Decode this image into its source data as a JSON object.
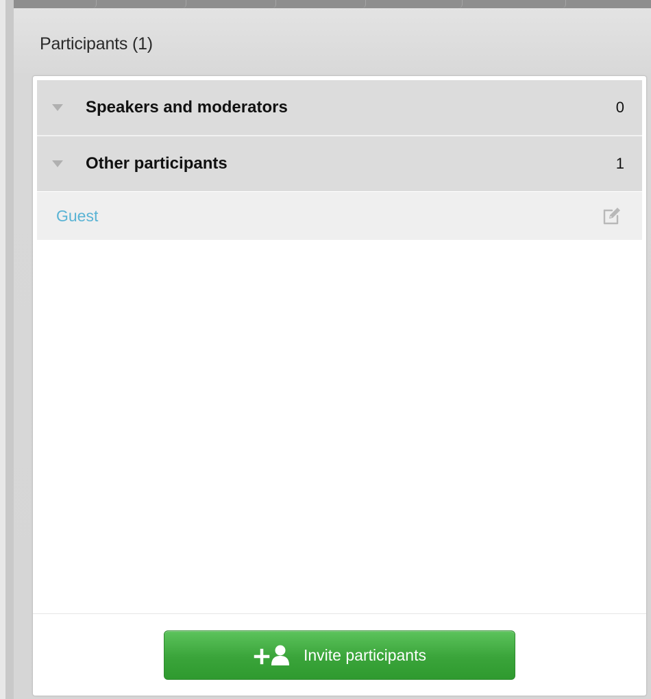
{
  "panel": {
    "title": "Participants (1)"
  },
  "groups": [
    {
      "label": "Speakers and moderators",
      "count": "0"
    },
    {
      "label": "Other participants",
      "count": "1"
    }
  ],
  "participants": [
    {
      "name": "Guest",
      "action_icon": "edit-icon"
    }
  ],
  "footer": {
    "invite_label": "Invite participants",
    "invite_icon": "add-user-icon"
  },
  "colors": {
    "accent_green": "#3aa43a",
    "guest_name": "#59b3d4",
    "group_header_bg": "#dcdcdc"
  }
}
